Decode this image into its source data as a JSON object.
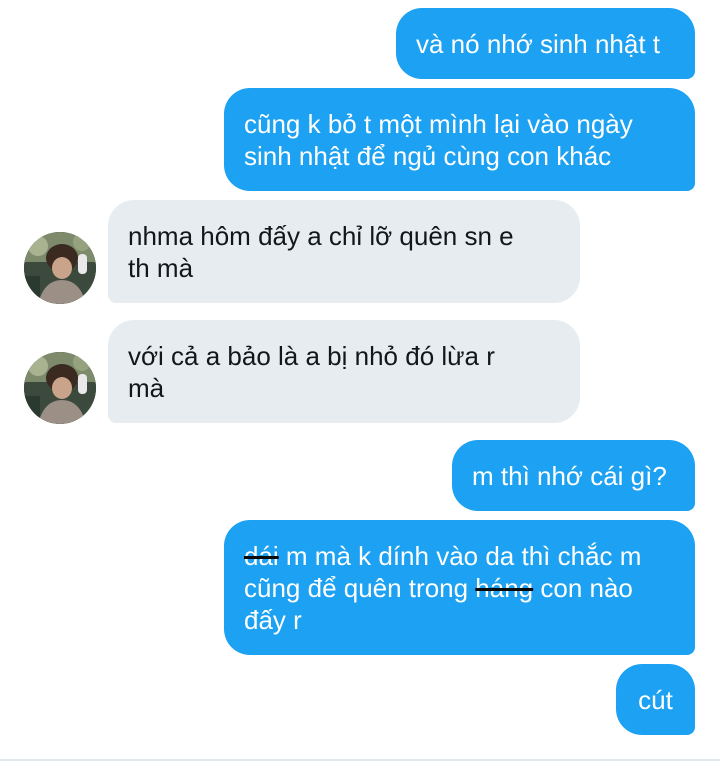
{
  "messages": [
    {
      "id": "m1",
      "side": "out",
      "lines": [
        "và nó nhớ sinh nhật t"
      ]
    },
    {
      "id": "m2",
      "side": "out",
      "lines": [
        "cũng k bỏ t một mình lại vào ngày",
        "sinh nhật để ngủ cùng con khác"
      ]
    },
    {
      "id": "m3",
      "side": "in",
      "lines": [
        "nhma hôm đấy a chỉ lỡ quên sn e",
        "th mà"
      ]
    },
    {
      "id": "m4",
      "side": "in",
      "lines": [
        "với cả a bảo là a bị nhỏ đó lừa r",
        "mà"
      ]
    },
    {
      "id": "m5",
      "side": "out",
      "lines": [
        "m thì nhớ cái gì?"
      ]
    },
    {
      "id": "m6",
      "side": "out",
      "line1_struck": "dái",
      "line1_rest": " m mà k dính vào da thì chắc m",
      "line2_pre": "cũng để quên trong ",
      "line2_struck": "háng",
      "line2_post": " con nào",
      "line3": "đấy r"
    },
    {
      "id": "m7",
      "side": "out",
      "lines": [
        "cút"
      ]
    }
  ],
  "colors": {
    "outgoing_bubble": "#1da1f2",
    "incoming_bubble": "#e6ecf0",
    "outgoing_text": "#ffffff",
    "incoming_text": "#14171a"
  },
  "icons": {
    "avatar": "profile-photo-avatar"
  }
}
